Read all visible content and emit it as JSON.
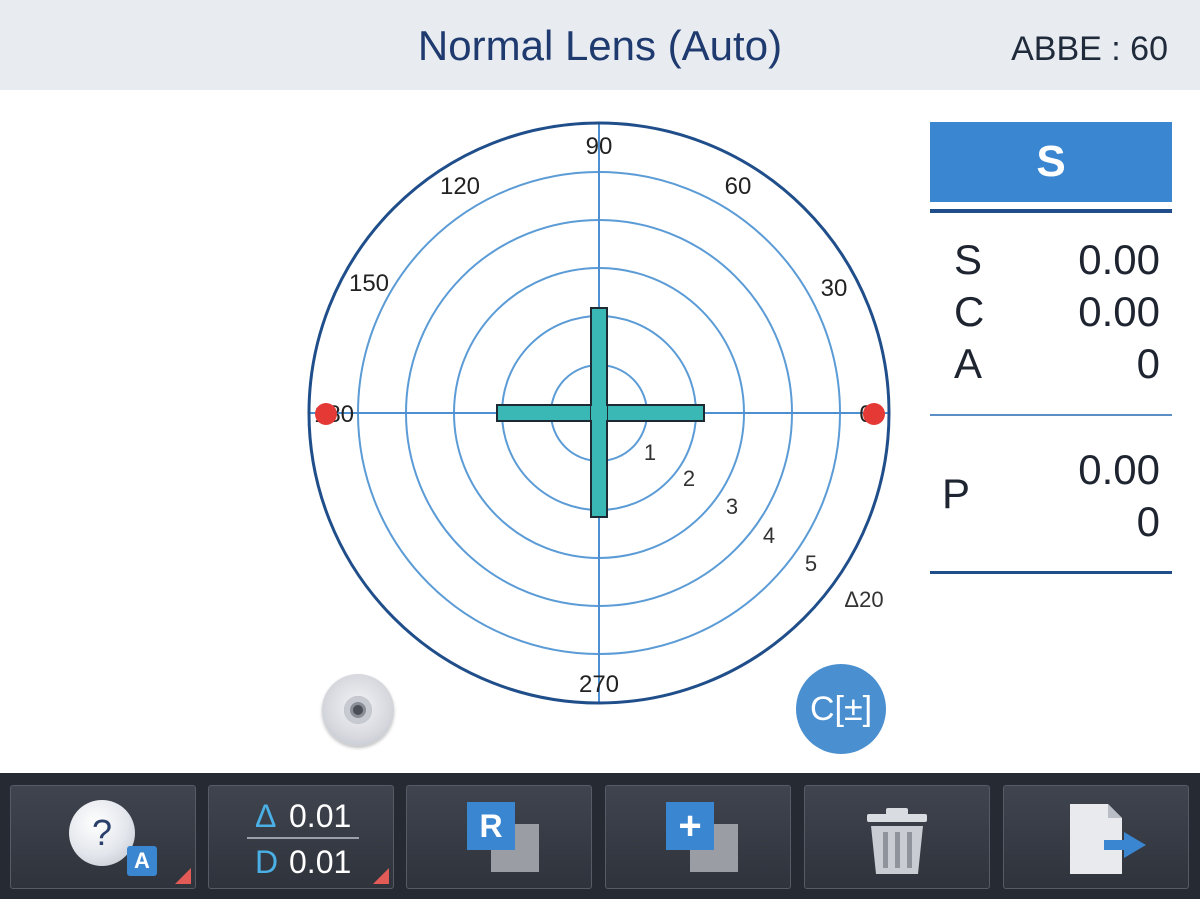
{
  "header": {
    "title": "Normal Lens (Auto)",
    "abbe": "ABBE : 60"
  },
  "polar": {
    "angle_labels": [
      "90",
      "120",
      "60",
      "150",
      "30",
      "270",
      "180",
      "0"
    ],
    "ring_labels": [
      "1",
      "2",
      "3",
      "4",
      "5"
    ],
    "scale_label": "Δ20",
    "marker_color": "#e53935",
    "cross_color": "#39b8b5"
  },
  "controls": {
    "c_button": "C[±]"
  },
  "panel": {
    "tab_label": "S",
    "rows": [
      {
        "label": "S",
        "value": "0.00"
      },
      {
        "label": "C",
        "value": "0.00"
      },
      {
        "label": "A",
        "value": "0"
      }
    ],
    "p_label": "P",
    "p_values": [
      "0.00",
      "0"
    ]
  },
  "toolbar": {
    "help_icon": "question-icon",
    "help_badge": "A",
    "step_prism_symbol": "Δ",
    "step_prism_value": "0.01",
    "step_diopter_symbol": "D",
    "step_diopter_value": "0.01",
    "r_label": "R",
    "add_label": "+",
    "delete_icon": "trash-icon",
    "exit_icon": "export-icon"
  },
  "colors": {
    "accent": "#3a86d0",
    "title": "#1e3a6e",
    "toolbar": "#262a33"
  }
}
